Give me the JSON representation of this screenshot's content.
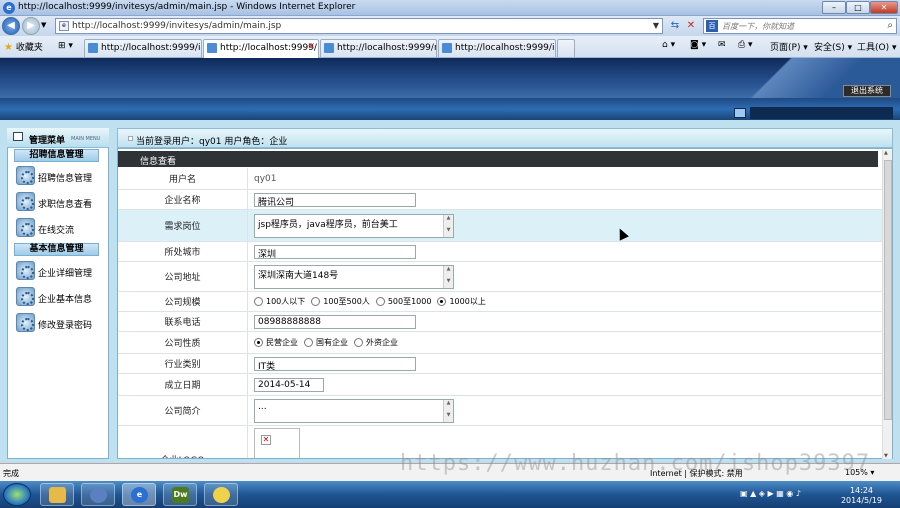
{
  "window": {
    "title": "http://localhost:9999/invitesys/admin/main.jsp - Windows Internet Explorer",
    "min_label": "–",
    "max_label": "□",
    "close_label": "✕"
  },
  "address": {
    "url": "http://localhost:9999/invitesys/admin/main.jsp",
    "search_placeholder": "百度一下，你就知道"
  },
  "favorites_label": "收藏夹",
  "tabs": [
    {
      "label": "http://localhost:9999/inv..."
    },
    {
      "label": "http://localhost:9999/..."
    },
    {
      "label": "http://localhost:9999/my..."
    },
    {
      "label": "http://localhost:9999/inv..."
    }
  ],
  "toolbar": {
    "page": "页面(P) ▾",
    "safety": "安全(S) ▾",
    "tools": "工具(O) ▾"
  },
  "app": {
    "logout": "退出系统",
    "user_info": "当前登录用户：qy01  用户角色：企业"
  },
  "sidebar": {
    "title": "管理菜单",
    "title_en": "MAIN MENU",
    "groups": [
      {
        "title": "招聘信息管理",
        "items": [
          "招聘信息管理",
          "求职信息查看",
          "在线交流"
        ]
      },
      {
        "title": "基本信息管理",
        "items": [
          "企业详细管理",
          "企业基本信息",
          "修改登录密码"
        ]
      }
    ]
  },
  "panel": {
    "header": "信息查看",
    "fields": {
      "username": {
        "label": "用户名",
        "value": "qy01"
      },
      "company": {
        "label": "企业名称",
        "value": "腾讯公司"
      },
      "positions": {
        "label": "需求岗位",
        "value": "jsp程序员，java程序员，前台美工"
      },
      "city": {
        "label": "所处城市",
        "value": "深圳"
      },
      "address": {
        "label": "公司地址",
        "value": "深圳深南大道148号"
      },
      "scale": {
        "label": "公司规模",
        "options": [
          "100人以下",
          "100至500人",
          "500至1000",
          "1000以上"
        ],
        "selected": 3
      },
      "phone": {
        "label": "联系电话",
        "value": "08988888888"
      },
      "nature": {
        "label": "公司性质",
        "options": [
          "民营企业",
          "国有企业",
          "外资企业"
        ],
        "selected": 0
      },
      "industry": {
        "label": "行业类别",
        "value": "IT类"
      },
      "founded": {
        "label": "成立日期",
        "value": "2014-05-14"
      },
      "intro": {
        "label": "公司简介",
        "value": "..."
      },
      "logo": {
        "label": "企业LOGO"
      }
    }
  },
  "status": {
    "text": "完成",
    "zone": "Internet | 保护模式: 禁用",
    "zoom": "105% ▾"
  },
  "watermark": "https://www.huzhan.com/ishop39397",
  "taskbar": {
    "time": "14:24",
    "date": "2014/5/19",
    "dw_label": "Dw"
  }
}
